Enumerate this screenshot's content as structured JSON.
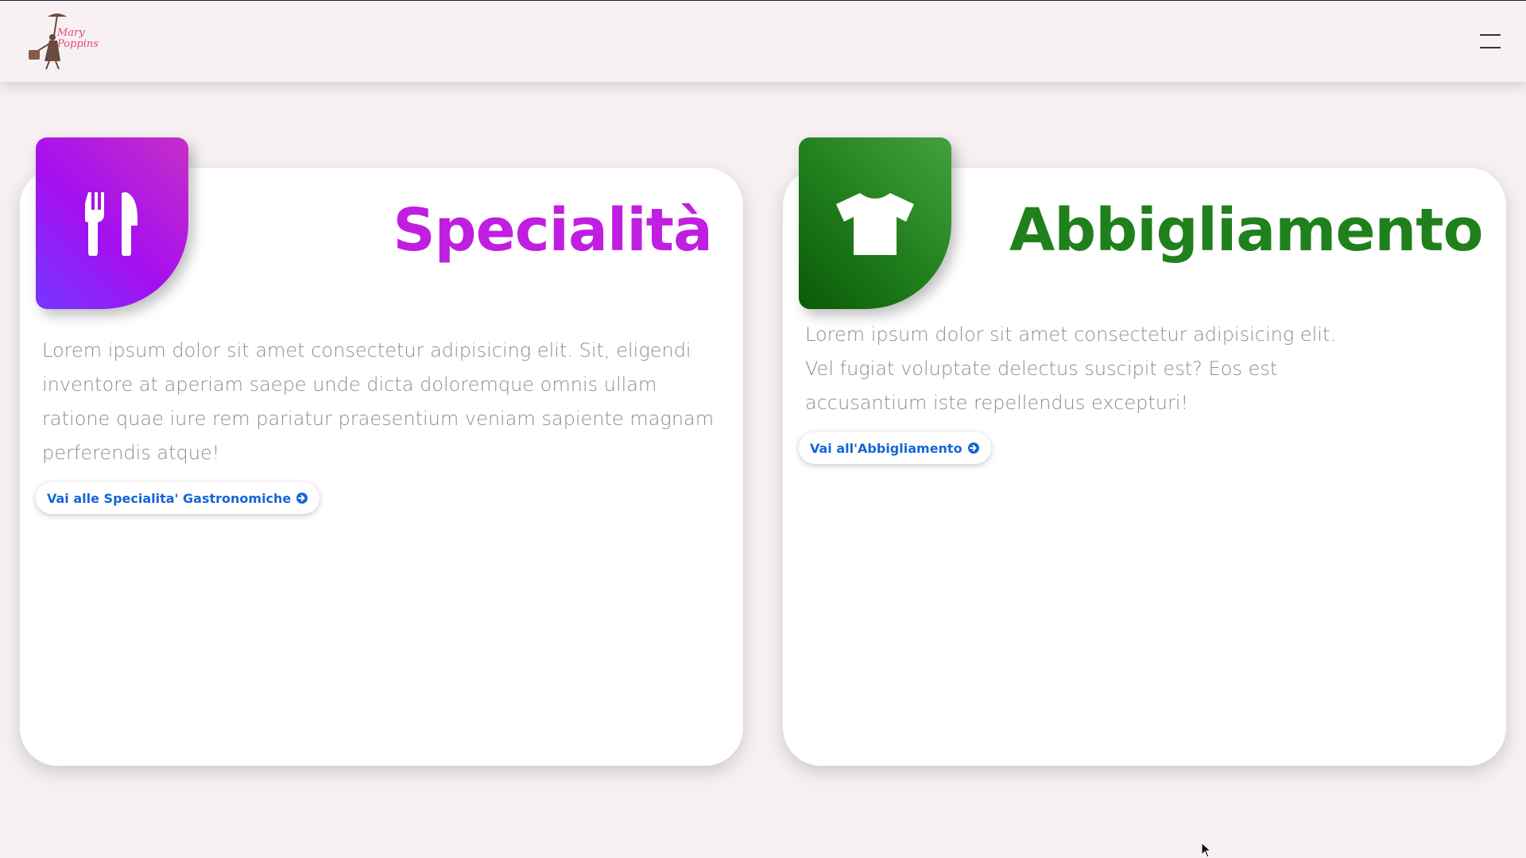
{
  "header": {
    "logo_icon": "mary-poppins-silhouette-icon",
    "logo_line1": "Mary",
    "logo_line2": "Poppins",
    "menu_icon": "hamburger-menu-icon"
  },
  "cards": [
    {
      "icon": "fork-knife-icon",
      "title": "Specialità",
      "text": "Lorem ipsum dolor sit amet consectetur adipisicing elit. Sit, eligendi inventore at aperiam saepe unde dicta doloremque omnis ullam ratione quae iure rem pariatur praesentium veniam sapiente magnam perferendis atque!",
      "button_label": "Vai alle Specialita' Gastronomiche",
      "button_icon": "arrow-circle-right-icon",
      "accent_color": "#c01ee0"
    },
    {
      "icon": "t-shirt-icon",
      "title": "Abbigliamento",
      "text": "Lorem ipsum dolor sit amet consectetur adipisicing elit. Vel fugiat voluptate delectus suscipit est? Eos est accusantium iste repellendus excepturi!",
      "button_label": "Vai all'Abbigliamento",
      "button_icon": "arrow-circle-right-icon",
      "accent_color": "#1f801c"
    }
  ],
  "colors": {
    "background": "#f6f0f2",
    "link": "#1566d6"
  }
}
